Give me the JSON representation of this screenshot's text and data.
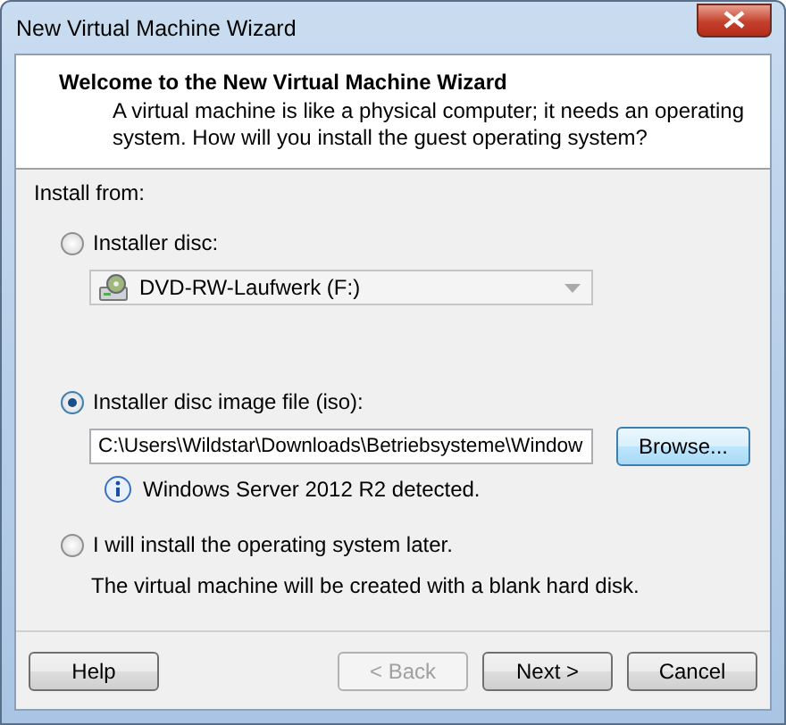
{
  "window": {
    "title": "New Virtual Machine Wizard"
  },
  "header": {
    "title": "Welcome to the New Virtual Machine Wizard",
    "description": "A virtual machine is like a physical computer; it needs an operating system. How will you install the guest operating system?"
  },
  "install_from_label": "Install from:",
  "options": [
    {
      "kind": "disc",
      "label": "Installer disc:",
      "selected": false,
      "drive": {
        "value": "DVD-RW-Laufwerk (F:)",
        "disabled": true
      }
    },
    {
      "kind": "image",
      "label": "Installer disc image file (iso):",
      "selected": true,
      "path": "C:\\Users\\Wildstar\\Downloads\\Betriebsysteme\\Window",
      "browse": "Browse...",
      "info": "Windows Server 2012 R2 detected."
    },
    {
      "kind": "later",
      "label": "I will install the operating system later.",
      "selected": false,
      "note": "The virtual machine will be created with a blank hard disk."
    }
  ],
  "buttons": [
    {
      "label": "Help",
      "disabled": false
    },
    {
      "label": "< Back",
      "disabled": true
    },
    {
      "label": "Next >",
      "disabled": false
    },
    {
      "label": "Cancel",
      "disabled": false
    }
  ]
}
